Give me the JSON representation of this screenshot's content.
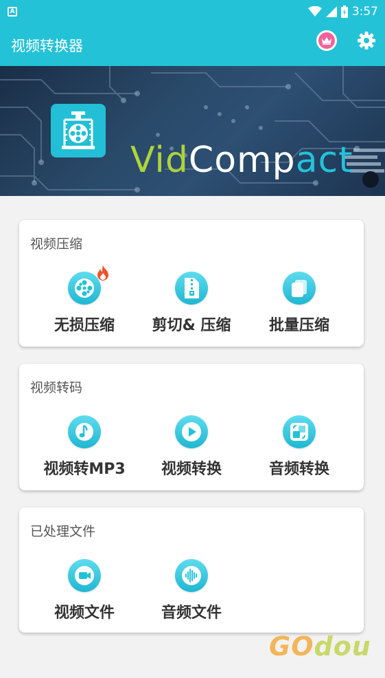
{
  "status_bar": {
    "time": "3:57",
    "left_icon": "A"
  },
  "app_bar": {
    "title": "视频转换器",
    "icons": [
      "crown-icon",
      "gear-icon"
    ]
  },
  "banner": {
    "brand_vid": "Vid",
    "brand_comp": "Comp",
    "brand_act": "act"
  },
  "sections": [
    {
      "title": "视频压缩",
      "items": [
        {
          "label": "无损压缩",
          "icon": "film-reel-icon",
          "badge": "fire-icon"
        },
        {
          "label": "剪切& 压缩",
          "icon": "zip-file-icon"
        },
        {
          "label": "批量压缩",
          "icon": "stacked-files-icon"
        }
      ]
    },
    {
      "title": "视频转码",
      "items": [
        {
          "label": "视频转MP3",
          "icon": "music-note-icon"
        },
        {
          "label": "视频转换",
          "icon": "play-icon"
        },
        {
          "label": "音频转换",
          "icon": "convert-icon"
        }
      ]
    },
    {
      "title": "已处理文件",
      "items": [
        {
          "label": "视频文件",
          "icon": "video-camera-icon"
        },
        {
          "label": "音频文件",
          "icon": "sound-wave-icon"
        }
      ]
    }
  ],
  "watermark": {
    "go": "GO",
    "dou": "dou"
  },
  "colors": {
    "primary": "#23c2d7",
    "accent_pink": "#f0629b",
    "background": "#f2f2f2"
  }
}
